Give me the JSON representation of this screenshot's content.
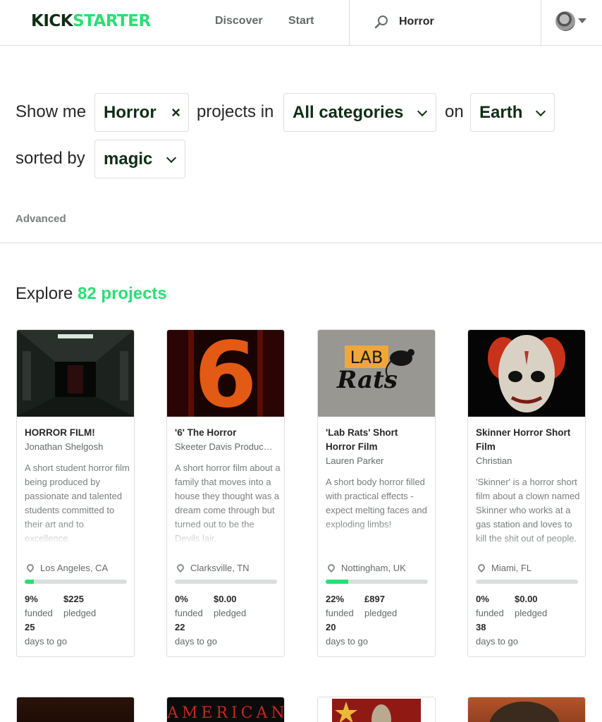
{
  "header": {
    "logo_part1": "KICK",
    "logo_part2": "STARTER",
    "nav_discover": "Discover",
    "nav_start": "Start",
    "search_value": "Horror"
  },
  "filters": {
    "show_me": "Show me",
    "term": "Horror",
    "clear_symbol": "×",
    "projects_in": "projects in",
    "category": "All categories",
    "on": "on",
    "location": "Earth",
    "sorted_by": "sorted by",
    "sort": "magic",
    "advanced": "Advanced"
  },
  "explore": {
    "label": "Explore",
    "count": "82 projects"
  },
  "colors": {
    "brand_dark": "#0f2e14",
    "brand_green": "#2bde73"
  },
  "projects": [
    {
      "title": "HORROR FILM!",
      "creator": "Jonathan Shelgosh",
      "blurb": "A short student horror film being produced by passionate and talented students committed to their art and to excellence.",
      "location": "Los Angeles, CA",
      "funded_pct": "9%",
      "funded_fraction": 0.09,
      "funded_label": "funded",
      "pledged": "$225",
      "pledged_label": "pledged",
      "days": "25",
      "days_label": "days to go"
    },
    {
      "title": "'6' The Horror",
      "creator": "Skeeter Davis Produc…",
      "blurb": "A short horror film about a family that moves into a house they thought was a dream come through but turned out to be the Devils lair.",
      "location": "Clarksville, TN",
      "funded_pct": "0%",
      "funded_fraction": 0.0,
      "funded_label": "funded",
      "pledged": "$0.00",
      "pledged_label": "pledged",
      "days": "22",
      "days_label": "days to go"
    },
    {
      "title": "'Lab Rats' Short Horror Film",
      "creator": "Lauren Parker",
      "blurb": "A short body horror filled with practical effects - expect melting faces and exploding limbs!",
      "location": "Nottingham, UK",
      "funded_pct": "22%",
      "funded_fraction": 0.22,
      "funded_label": "funded",
      "pledged": "£897",
      "pledged_label": "pledged",
      "days": "20",
      "days_label": "days to go"
    },
    {
      "title": "Skinner Horror Short Film",
      "creator": "Christian",
      "blurb": "'Skinner' is a horror short film about a clown named Skinner who works at a gas station and loves to kill the shit out of people.",
      "location": "Miami, FL",
      "funded_pct": "0%",
      "funded_fraction": 0.0,
      "funded_label": "funded",
      "pledged": "$0.00",
      "pledged_label": "pledged",
      "days": "38",
      "days_label": "days to go"
    }
  ],
  "thumb_text": {
    "six": "6",
    "lab": "LAB",
    "rats": "Rats",
    "american": "AMERICAN"
  }
}
